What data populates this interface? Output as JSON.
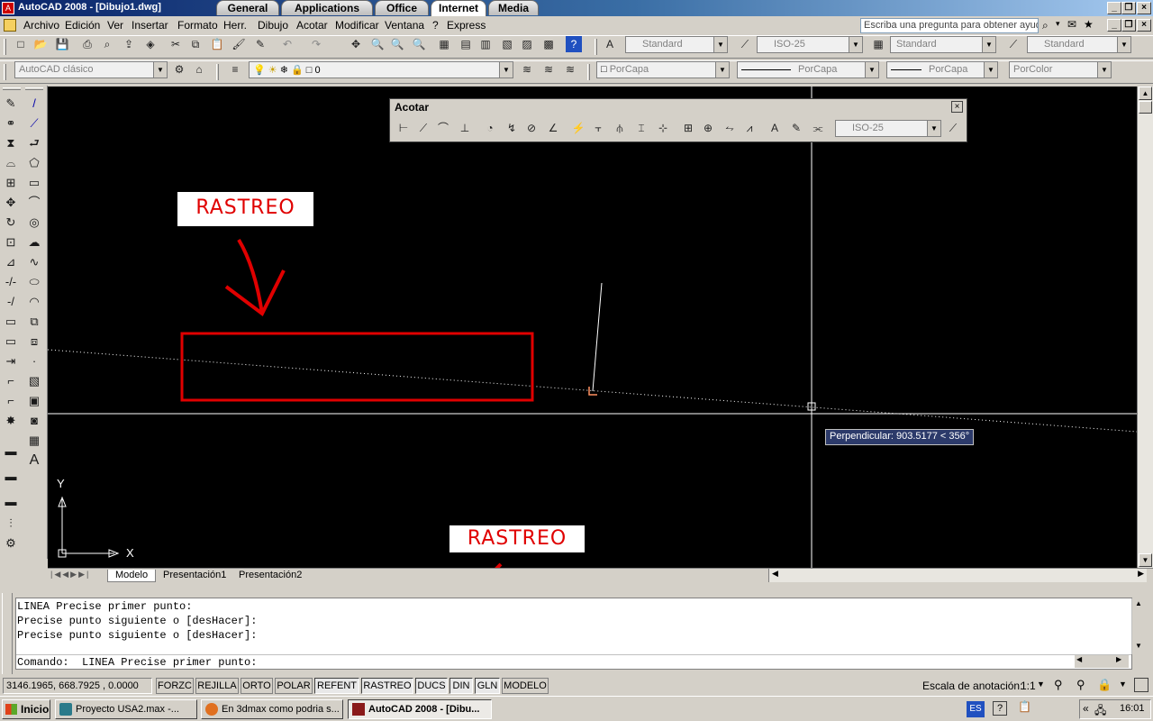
{
  "window": {
    "title": "AutoCAD 2008 - [Dibujo1.dwg]",
    "tabs": [
      "General",
      "Applications",
      "Office",
      "Internet",
      "Media"
    ],
    "active_tab": "Internet"
  },
  "menu": {
    "items": [
      "Archivo",
      "Edición",
      "Ver",
      "Insertar",
      "Formato",
      "Herr.",
      "Dibujo",
      "Acotar",
      "Modificar",
      "Ventana",
      "?",
      "Express"
    ],
    "help_placeholder": "Escriba una pregunta para obtener ayuda"
  },
  "toolbars": {
    "text_style": "Standard",
    "dim_style": "ISO-25",
    "table_style": "Standard",
    "multileader_style": "Standard",
    "workspace": "AutoCAD clásico",
    "layer": "0",
    "color": "PorCapa",
    "linetype": "PorCapa",
    "lineweight": "PorCapa",
    "plotstyle": "PorColor"
  },
  "dim_toolbar": {
    "title": "Acotar",
    "style": "ISO-25"
  },
  "canvas": {
    "tooltip": "Perpendicular: 903.5177 < 356°",
    "ucs_x": "X",
    "ucs_y": "Y"
  },
  "annotations": {
    "label_top": "RASTREO",
    "label_bottom": "RASTREO",
    "color": "#e00000"
  },
  "layout_tabs": [
    "Modelo",
    "Presentación1",
    "Presentación2"
  ],
  "command": {
    "history": [
      "LINEA Precise primer punto:",
      "Precise punto siguiente o [desHacer]:",
      "Precise punto siguiente o [desHacer]:"
    ],
    "prompt": "Comando:  LINEA Precise primer punto:"
  },
  "status": {
    "coords": "3146.1965, 668.7925 , 0.0000",
    "buttons": [
      "FORZC",
      "REJILLA",
      "ORTO",
      "POLAR",
      "REFENT",
      "RASTREO",
      "DUCS",
      "DIN",
      "GLN",
      "MODELO"
    ],
    "annotation_scale_label": "Escala de anotación:",
    "annotation_scale": "1:1"
  },
  "taskbar": {
    "start": "Inicio",
    "tasks": [
      "Proyecto USA2.max",
      "En 3dmax como podria s...",
      "AutoCAD 2008 - [Dibu..."
    ],
    "tasks_extra": "-...",
    "lang": "ES",
    "clock": "16:01"
  }
}
